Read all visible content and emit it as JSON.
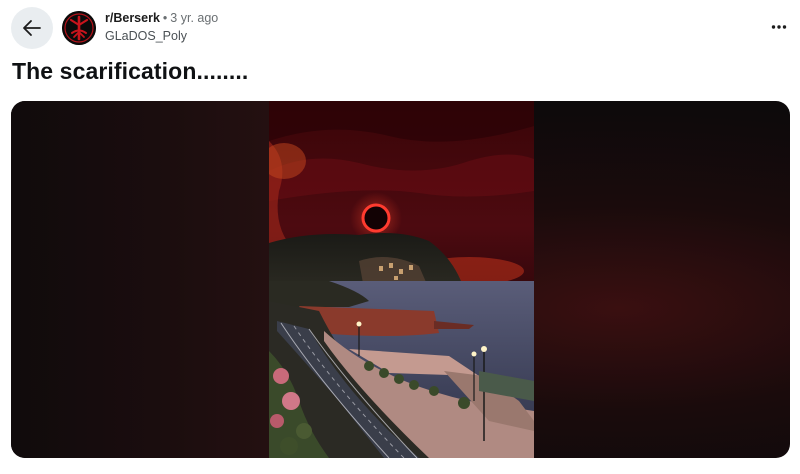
{
  "post": {
    "subreddit": "r/Berserk",
    "separator": "•",
    "age": "3 yr. ago",
    "author": "GLaDOS_Poly",
    "title": "The scarification........"
  },
  "icons": {
    "back": "arrow-left-icon",
    "more": "more-horizontal-icon",
    "avatar": "brand-of-sacrifice-icon"
  },
  "colors": {
    "back_button_bg": "#e9edf0",
    "text_primary": "#1c1c1c",
    "text_secondary": "#6a6f72",
    "eclipse_ring": "#ff3b2f"
  }
}
